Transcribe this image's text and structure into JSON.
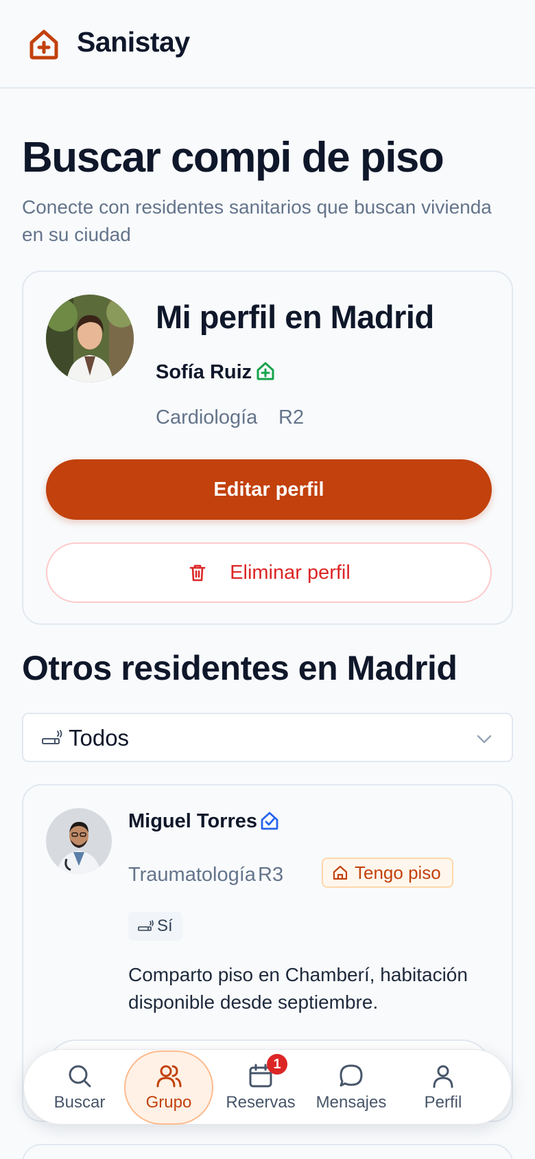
{
  "header": {
    "brand": "Sanistay"
  },
  "page": {
    "title": "Buscar compi de piso",
    "subtitle": "Conecte con residentes sanitarios que buscan vivienda en su ciudad"
  },
  "my_profile": {
    "title": "Mi perfil en Madrid",
    "name": "Sofía Ruiz",
    "specialty": "Cardiología",
    "year": "R2",
    "edit_label": "Editar perfil",
    "delete_label": "Eliminar perfil"
  },
  "others": {
    "title": "Otros residentes en Madrid",
    "filter": {
      "selected": "Todos"
    }
  },
  "residents": [
    {
      "name": "Miguel Torres",
      "specialty": "Traumatología",
      "year": "R3",
      "housing_tag": "Tengo piso",
      "smoker_tag": "Sí",
      "bio": "Comparto piso en Chamberí, habitación disponible desde septiembre."
    }
  ],
  "nav": {
    "items": [
      {
        "label": "Buscar",
        "icon": "search-icon"
      },
      {
        "label": "Grupo",
        "icon": "users-icon"
      },
      {
        "label": "Reservas",
        "icon": "calendar-icon",
        "badge": "1"
      },
      {
        "label": "Mensajes",
        "icon": "chat-icon"
      },
      {
        "label": "Perfil",
        "icon": "user-icon"
      }
    ],
    "active": "Grupo"
  },
  "colors": {
    "accent": "#c2410c",
    "danger": "#dc2626",
    "verified_green": "#16a34a",
    "verified_blue": "#2563eb"
  }
}
